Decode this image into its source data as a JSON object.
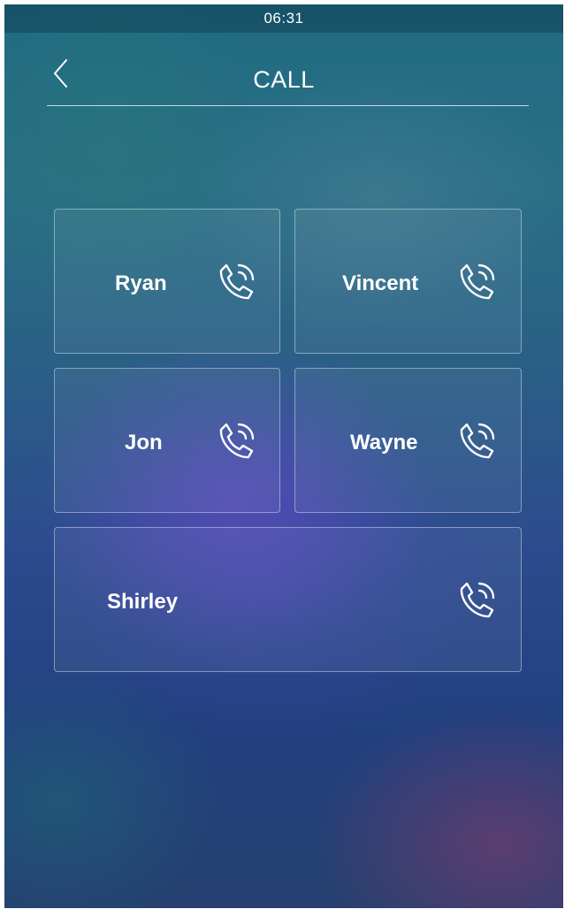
{
  "status_bar": {
    "time": "06:31"
  },
  "header": {
    "title": "CALL",
    "back_icon": "chevron-left-icon"
  },
  "contacts": [
    {
      "name": "Ryan",
      "icon": "phone-call-icon"
    },
    {
      "name": "Vincent",
      "icon": "phone-call-icon"
    },
    {
      "name": "Jon",
      "icon": "phone-call-icon"
    },
    {
      "name": "Wayne",
      "icon": "phone-call-icon"
    },
    {
      "name": "Shirley",
      "icon": "phone-call-icon"
    }
  ],
  "colors": {
    "text": "#ffffff",
    "card_border": "#c8d2e6"
  }
}
